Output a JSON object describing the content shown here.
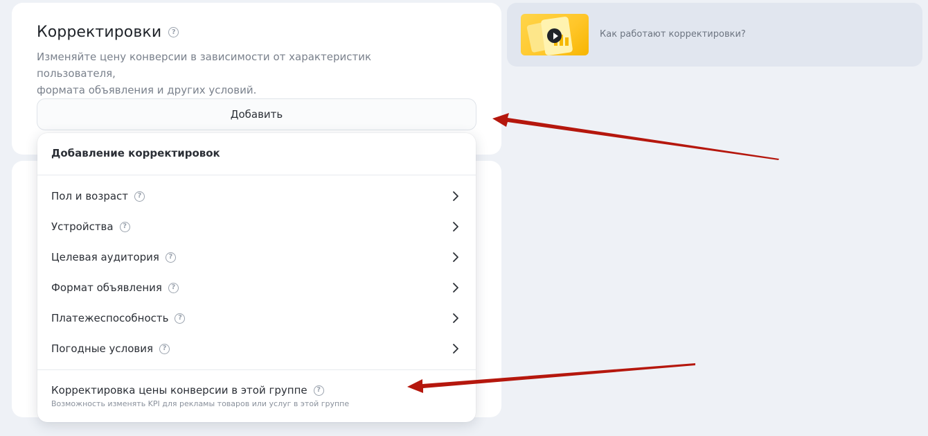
{
  "main_card": {
    "title": "Корректировки",
    "description_line1": "Изменяйте цену конверсии в зависимости от характеристик пользователя,",
    "description_line2": "формата объявления и других условий.",
    "add_button": "Добавить"
  },
  "info_card": {
    "link_text": "Как работают корректировки?",
    "thumbnail_icon": "play-video-icon"
  },
  "dropdown": {
    "title": "Добавление корректировок",
    "items": [
      {
        "label": "Пол и возраст"
      },
      {
        "label": "Устройства"
      },
      {
        "label": "Целевая аудитория"
      },
      {
        "label": "Формат объявления"
      },
      {
        "label": "Платежеспособность"
      },
      {
        "label": "Погодные условия"
      }
    ],
    "bottom_item": {
      "label": "Корректировка цены конверсии в этой группе",
      "sublabel": "Возможность изменять KPI для рекламы товаров или услуг в этой группе"
    }
  },
  "colors": {
    "background": "#eef1f6",
    "card": "#ffffff",
    "info_card": "#e1e6ef",
    "annotation_arrow": "#b5170d",
    "thumbnail_accent": "#ffc629"
  }
}
